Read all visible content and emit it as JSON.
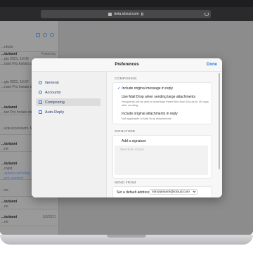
{
  "browser": {
    "url": "beta.icloud.com"
  },
  "mail_list": {
    "items": [
      {
        "from": "",
        "date": "",
        "lines": [
          "...ntoso"
        ]
      },
      {
        "from": "...tarianni",
        "date": "Yesterday",
        "lines": [
          "...giu 2021, 10:09",
          "...narri Pro Inviato da..."
        ]
      },
      {
        "from": "",
        "date": "",
        "lines": [
          "...giu 2021, 10:07",
          "...narri Pro Inviato da..."
        ]
      },
      {
        "from": "...tarianni",
        "date": "",
        "lines": [
          "...tari Pro Inviato da..."
        ]
      },
      {
        "from": "",
        "date": "",
        "lines": [
          "...urla scorsoiumi. M"
        ]
      },
      {
        "from": "...tarianni",
        "date": "",
        "lines": [
          "...ne"
        ]
      },
      {
        "from": "...tarianni",
        "date": "",
        "lines": [
          "...ropst",
          "...apleco.ca/hollop...",
          "...pro-unuoted"
        ]
      },
      {
        "from": "",
        "date": "",
        "lines": [
          "...ne"
        ]
      },
      {
        "from": "...tarianni",
        "date": "",
        "lines": [
          "...ne"
        ]
      },
      {
        "from": "...tarianni",
        "date": "1/8/2021",
        "lines": [
          "...ne"
        ]
      }
    ]
  },
  "preferences": {
    "title": "Preferences",
    "done_label": "Done",
    "nav": [
      {
        "label": "General",
        "icon": "gear-icon"
      },
      {
        "label": "Accounts",
        "icon": "at-icon"
      },
      {
        "label": "Composing",
        "icon": "compose-icon",
        "active": true
      },
      {
        "label": "Auto-Reply",
        "icon": "plane-icon"
      }
    ],
    "composing": {
      "section_title": "COMPOSING",
      "include_original": "Include original message in reply",
      "mail_drop": "Use Mail Drop when sending large attachments",
      "mail_drop_sub": "Recipients will be able to download these files from iCloud for 30 days after sending.",
      "include_attachments": "Include original attachments in reply",
      "include_attachments_sub": "Not applicable to Mail Drop attachments"
    },
    "signature": {
      "section_title": "SIGNATURE",
      "add_label": "Add a signature",
      "placeholder": "Sent from iCloud"
    },
    "send_from": {
      "section_title": "SEND FROM",
      "default_label": "Set a default address:",
      "default_value": "minotarianni@icloud.com"
    }
  }
}
